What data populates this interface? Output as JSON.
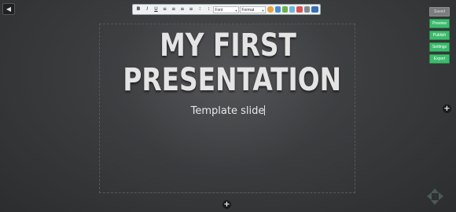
{
  "nav": {
    "back_glyph": "◀"
  },
  "toolbar": {
    "buttons": [
      {
        "name": "bold-button",
        "glyph": "B"
      },
      {
        "name": "italic-button",
        "glyph": "I"
      },
      {
        "name": "underline-button",
        "glyph": "U"
      },
      {
        "name": "align-left-icon",
        "glyph": "≡"
      },
      {
        "name": "align-center-icon",
        "glyph": "≡"
      },
      {
        "name": "align-right-icon",
        "glyph": "≡"
      },
      {
        "name": "justify-icon",
        "glyph": "≡"
      },
      {
        "name": "bullet-list-icon",
        "glyph": "⁝"
      },
      {
        "name": "numbered-list-icon",
        "glyph": "⁝"
      }
    ],
    "font_select": "Font",
    "format_select": "Format",
    "icon_colors": [
      "#e9a43b",
      "#4a8fd1",
      "#6ab04c",
      "#6fb3e0",
      "#d9534f",
      "#7d8a93",
      "#3b6fb5"
    ]
  },
  "slide": {
    "title_line1": "MY FIRST",
    "title_line2": "PRESENTATION",
    "subtitle": "Template slide"
  },
  "side_menu": {
    "saved": "Saved",
    "preview": "Preview",
    "publish": "Publish",
    "settings": "Settings",
    "export": "Export"
  },
  "controls": {
    "add_glyph": "+"
  },
  "colors": {
    "accent": "#3dbb6d",
    "background": "#3a3c3e"
  }
}
